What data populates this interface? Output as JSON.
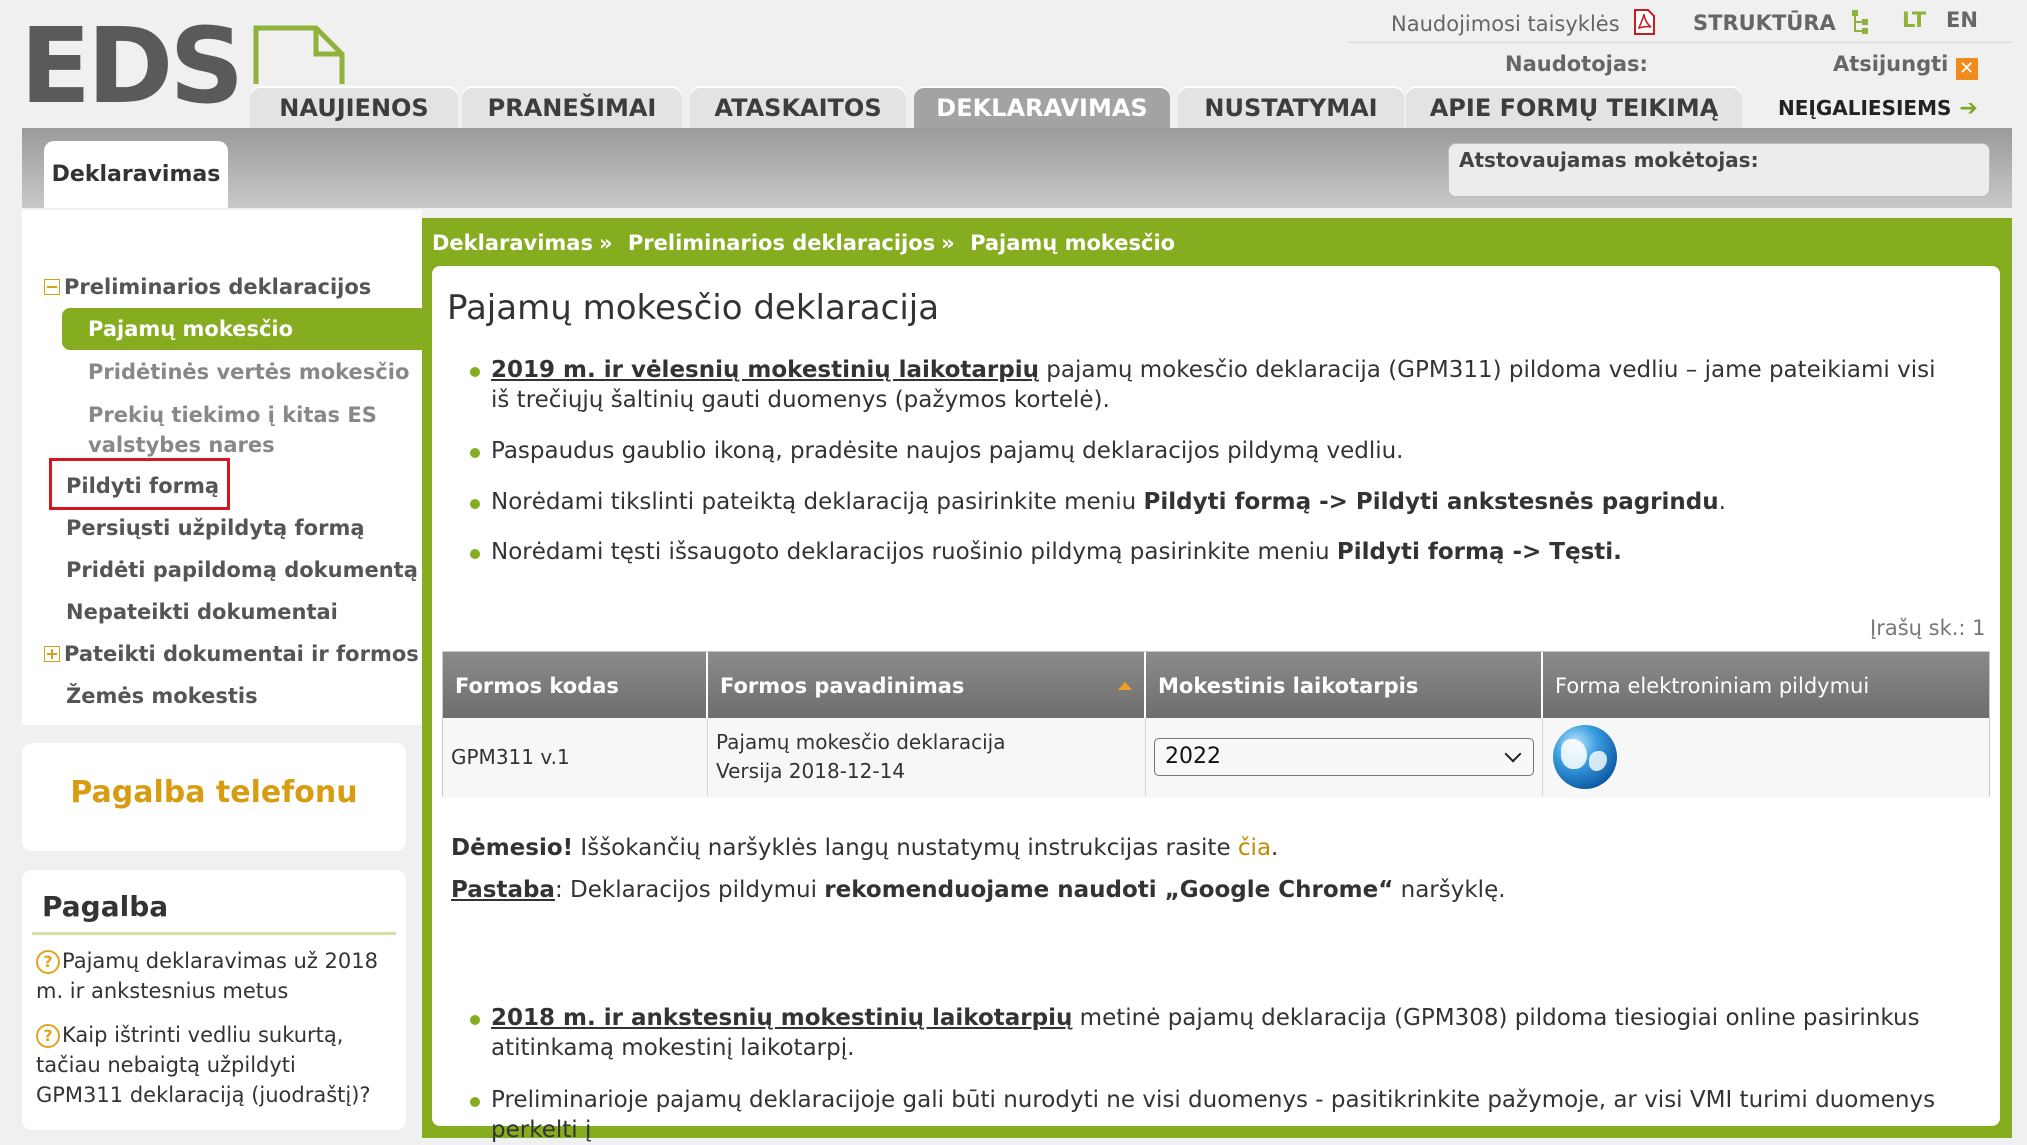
{
  "logo": {
    "text": "EDS"
  },
  "toplinks": {
    "terms": "Naudojimosi taisyklės",
    "structure": "STRUKTŪRA",
    "lang_lt": "LT",
    "lang_en": "EN",
    "user_label": "Naudotojas:",
    "logout": "Atsijungti"
  },
  "nav": {
    "tabs": [
      {
        "label": "NAUJIENOS",
        "active": false
      },
      {
        "label": "PRANEŠIMAI",
        "active": false
      },
      {
        "label": "ATASKAITOS",
        "active": false
      },
      {
        "label": "DEKLARAVIMAS",
        "active": true
      },
      {
        "label": "NUSTATYMAI",
        "active": false
      },
      {
        "label": "APIE FORMŲ TEIKIMĄ",
        "active": false
      }
    ],
    "disabled_link": "NEĮGALIESIEMS"
  },
  "band": {
    "tab": "Deklaravimas",
    "represented_label": "Atstovaujamas mokėtojas:"
  },
  "sidebar": {
    "group1": "Preliminarios deklaracijos",
    "active": "Pajamų mokesčio",
    "sub2": "Pridėtinės vertės mokesčio",
    "sub3_line1": "Prekių tiekimo į kitas ES",
    "sub3_line2": "valstybes nares",
    "fill_form": "Pildyti formą",
    "send_form": "Persiųsti užpildytą formą",
    "add_doc": "Pridėti papildomą dokumentą",
    "unsent": "Nepateikti dokumentai",
    "group2": "Pateikti dokumentai ir formos",
    "land_tax": "Žemės mokestis"
  },
  "phone": {
    "label": "Pagalba telefonu"
  },
  "help": {
    "title": "Pagalba",
    "item1": "Pajamų deklaravimas už 2018 m. ir ankstesnius metus",
    "item2": "Kaip ištrinti vedliu sukurtą, tačiau nebaigtą užpildyti GPM311 deklaraciją (juodraštį)?"
  },
  "breadcrumb": {
    "c1": "Deklaravimas",
    "c2": "Preliminarios deklaracijos",
    "c3": "Pajamų mokesčio",
    "sep": "»"
  },
  "main": {
    "title": "Pajamų mokesčio deklaracija",
    "b1_link": "2019 m. ir vėlesnių mokestinių laikotarpių",
    "b1_text": " pajamų mokesčio deklaracija (GPM311) pildoma vedliu – jame pateikiami visi iš trečiųjų šaltinių gauti duomenys (pažymos kortelė).",
    "b2": "Paspaudus gaublio ikoną, pradėsite naujos pajamų deklaracijos pildymą vedliu.",
    "b3_pre": "Norėdami tikslinti pateiktą deklaraciją pasirinkite meniu ",
    "b3_bold": "Pildyti formą -> Pildyti ankstesnės pagrindu",
    "b3_post": ".",
    "b4_pre": "Norėdami tęsti išsaugoto deklaracijos ruošinio pildymą pasirinkite meniu ",
    "b4_bold": "Pildyti formą -> Tęsti.",
    "records": "Įrašų sk.: 1",
    "attention_bold": "Dėmesio!",
    "attention_text": " Iššokančių naršyklės langų nustatymų instrukcijas rasite ",
    "attention_link": "čia",
    "attention_end": ".",
    "note_label": "Pastaba",
    "note_text": ": Deklaracijos pildymui ",
    "note_bold": "rekomenduojame naudoti „Google Chrome“",
    "note_end": " naršyklę.",
    "b5_link": "2018 m. ir ankstesnių mokestinių laikotarpių",
    "b5_text": " metinė pajamų deklaracija (GPM308) pildoma tiesiogiai online pasirinkus atitinkamą mokestinį laikotarpį.",
    "b6": "Preliminarioje pajamų deklaracijoje gali būti nurodyti ne visi duomenys - pasitikrinkite pažymoje, ar visi VMI turimi duomenys perkelti į"
  },
  "table": {
    "headers": [
      "Formos kodas",
      "Formos pavadinimas",
      "Mokestinis laikotarpis",
      "Forma elektroniniam pildymui"
    ],
    "row": {
      "code": "GPM311 v.1",
      "name": "Pajamų mokesčio deklaracija",
      "version": "Versija 2018-12-14",
      "period": "2022"
    }
  },
  "colors": {
    "accent": "#86ac1f",
    "gold": "#d89c12",
    "error_box": "#d9141e"
  }
}
